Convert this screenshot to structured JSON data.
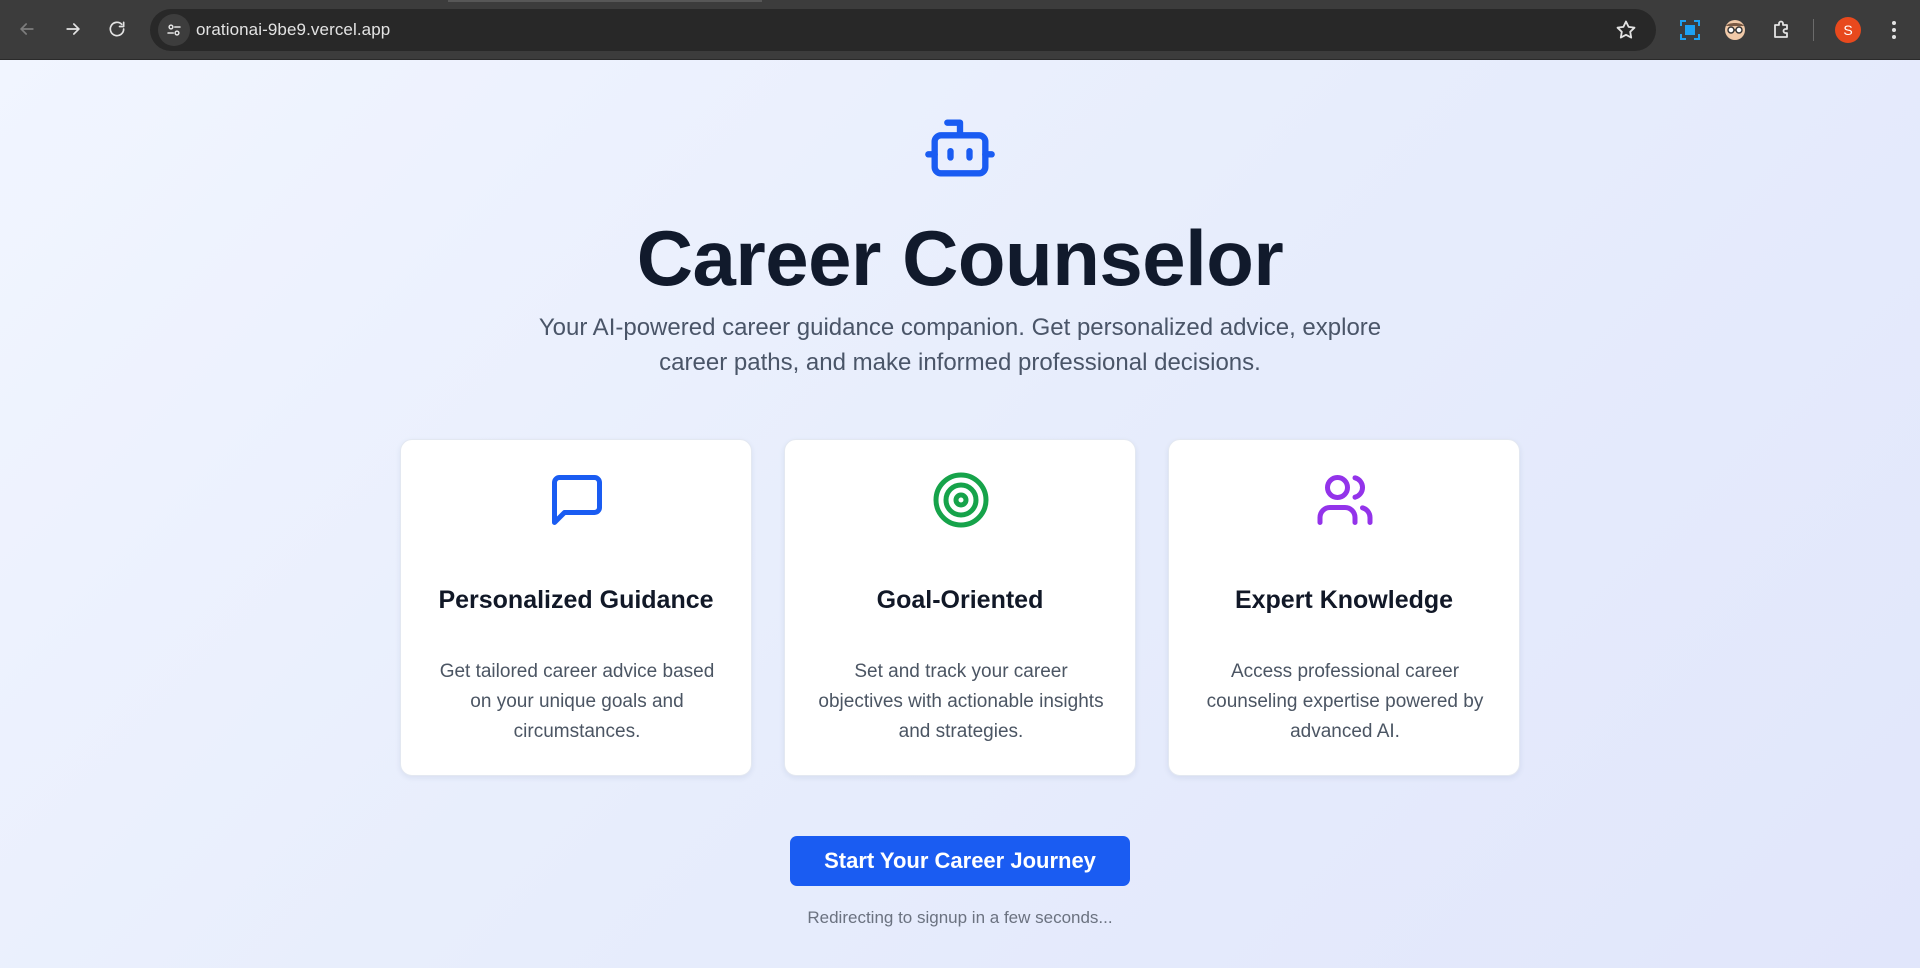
{
  "browser": {
    "url": "orationai-9be9.vercel.app",
    "profile_initial": "S",
    "profile_color": "#e8491d",
    "icons": {
      "back": "arrow-left-icon",
      "forward": "arrow-right-icon",
      "reload": "reload-icon",
      "site_info": "tune-icon",
      "bookmark": "star-icon",
      "extension_1": "screen-capture-icon",
      "extension_2": "glasses-face-icon",
      "extensions": "puzzle-icon",
      "menu": "kebab-menu-icon"
    }
  },
  "hero": {
    "icon": "robot-icon",
    "title": "Career Counselor",
    "subtitle": "Your AI-powered career guidance companion. Get personalized advice, explore career paths, and make informed professional decisions."
  },
  "features": [
    {
      "icon": "message-square-icon",
      "icon_color": "#1a5cf2",
      "title": "Personalized Guidance",
      "description": "Get tailored career advice based on your unique goals and circumstances."
    },
    {
      "icon": "target-icon",
      "icon_color": "#16a34a",
      "title": "Goal-Oriented",
      "description": "Set and track your career objectives with actionable insights and strategies."
    },
    {
      "icon": "users-icon",
      "icon_color": "#9333ea",
      "title": "Expert Knowledge",
      "description": "Access professional career counseling expertise powered by advanced AI."
    }
  ],
  "cta": {
    "label": "Start Your Career Journey",
    "color": "#1a5cf2"
  },
  "redirect_notice": "Redirecting to signup in a few seconds..."
}
